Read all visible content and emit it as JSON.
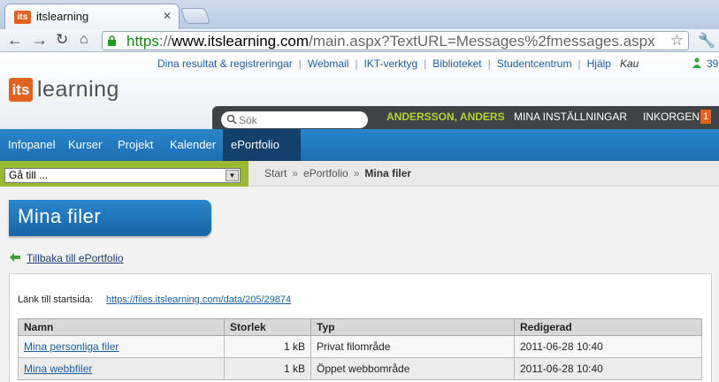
{
  "browser": {
    "tab_title": "itslearning",
    "favicon_text": "its",
    "tab_close": "✕",
    "url_scheme": "https",
    "url_sep": "://",
    "url_host": "www.itslearning.com",
    "url_rest": "/main.aspx?TextURL=Messages%2fmessages.aspx"
  },
  "toplinks": [
    "Dina resultat & registreringar",
    "Webmail",
    "IKT-verktyg",
    "Biblioteket",
    "Studentcentrum",
    "Hjälp"
  ],
  "toplinks_extra": "Kau",
  "online_count": "39",
  "logo": {
    "badge": "its",
    "text": "learning"
  },
  "header": {
    "search_placeholder": "Sök",
    "user_name": "ANDERSSON, ANDERS",
    "settings": "MINA INSTÄLLNINGAR",
    "inbox": "INKORGEN",
    "inbox_count": "1"
  },
  "nav": [
    "Infopanel",
    "Kurser",
    "Projekt",
    "Kalender",
    "ePortfolio"
  ],
  "nav_active_index": 4,
  "goto": {
    "value": "Gå till ..."
  },
  "breadcrumb": {
    "items": [
      "Start",
      "ePortfolio"
    ],
    "current": "Mina filer",
    "sep": "»"
  },
  "page": {
    "title": "Mina filer",
    "back_link": "Tillbaka till ePortfolio",
    "start_label": "Länk till startsida:",
    "start_url": "https://files.itslearning.com/data/205/29874"
  },
  "table": {
    "headers": [
      "Namn",
      "Storlek",
      "Typ",
      "Redigerad"
    ],
    "rows": [
      [
        "Mina personliga filer",
        "1 kB",
        "Privat filområde",
        "2011-06-28 10:40"
      ],
      [
        "Mina webbfiler",
        "1 kB",
        "Öppet webbområde",
        "2011-06-28 10:40"
      ]
    ]
  },
  "colors": {
    "accent_orange": "#e2631f",
    "nav_blue": "#1d6fb0",
    "user_green": "#b4d334"
  }
}
